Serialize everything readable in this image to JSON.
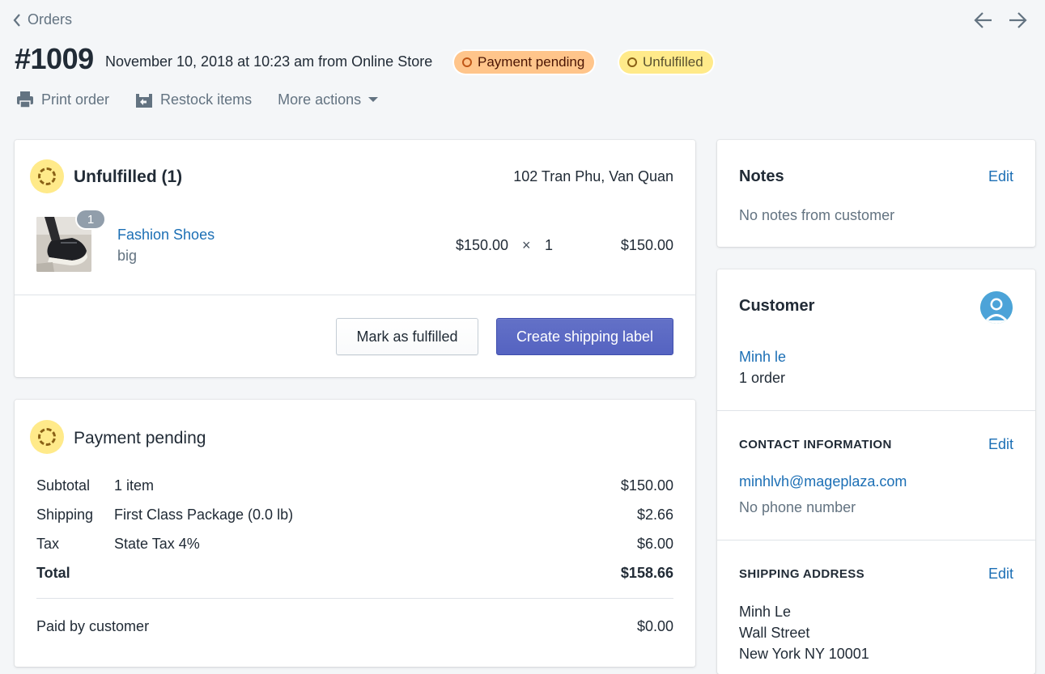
{
  "nav": {
    "back_label": "Orders"
  },
  "order": {
    "number": "#1009",
    "date_line": "November 10, 2018 at 10:23 am from Online Store",
    "payment_badge": "Payment pending",
    "fulfillment_badge": "Unfulfilled"
  },
  "actions": {
    "print": "Print order",
    "restock": "Restock items",
    "more": "More actions"
  },
  "unfulfilled": {
    "title": "Unfulfilled (1)",
    "location": "102 Tran Phu, Van Quan",
    "item": {
      "name": "Fashion Shoes",
      "variant": "big",
      "quantity_badge": "1",
      "price": "$150.00",
      "times": "×",
      "qty": "1",
      "total": "$150.00"
    },
    "mark_button": "Mark as fulfilled",
    "label_button": "Create shipping label"
  },
  "payment": {
    "title": "Payment pending",
    "rows": [
      {
        "label": "Subtotal",
        "desc": "1 item",
        "amount": "$150.00"
      },
      {
        "label": "Shipping",
        "desc": "First Class Package (0.0 lb)",
        "amount": "$2.66"
      },
      {
        "label": "Tax",
        "desc": "State Tax 4%",
        "amount": "$6.00"
      }
    ],
    "total_label": "Total",
    "total_amount": "$158.66",
    "paid_label": "Paid by customer",
    "paid_amount": "$0.00"
  },
  "notes": {
    "title": "Notes",
    "edit": "Edit",
    "text": "No notes from customer"
  },
  "customer": {
    "title": "Customer",
    "name": "Minh le",
    "orders": "1 order",
    "contact_title": "CONTACT INFORMATION",
    "contact_edit": "Edit",
    "email": "minhlvh@mageplaza.com",
    "phone": "No phone number",
    "shipping_title": "SHIPPING ADDRESS",
    "shipping_edit": "Edit",
    "address": [
      "Minh Le",
      "Wall Street",
      "New York NY 10001"
    ]
  },
  "colors": {
    "primary": "#5c6ac4",
    "link": "#1c6fb5",
    "attention": "#ffc58b",
    "warning": "#ffea8a"
  },
  "icons": [
    "chevron-left-icon",
    "arrow-left-icon",
    "arrow-right-icon",
    "printer-icon",
    "restock-icon",
    "caret-down-icon",
    "incomplete-circle-icon",
    "avatar-icon"
  ]
}
